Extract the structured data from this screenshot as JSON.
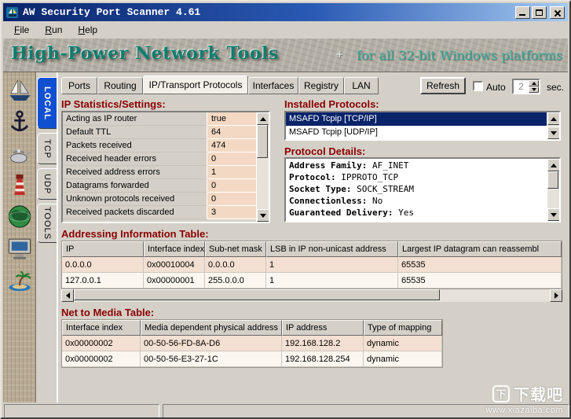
{
  "colors": {
    "titlebar_left": "#0a246a",
    "titlebar_right": "#a6caf0",
    "base_gray": "#d4d0c8",
    "local_tab_blue": "#1050d0",
    "selection_blue": "#0a246a",
    "heading_red": "#8b0000",
    "value_cell_bg": "#f3d9c3",
    "banner_teal": "#0d7d6e",
    "banner_subtitle_teal": "#3aaf9f"
  },
  "window": {
    "title": "AW Security Port Scanner 4.61"
  },
  "menu": [
    "File",
    "Run",
    "Help"
  ],
  "banner": {
    "title": "High-Power Network Tools",
    "spark": "+",
    "subtitle": "for all 32-bit Windows platforms"
  },
  "sidebar_icons": [
    "sailboat",
    "anchor",
    "lamp",
    "lighthouse",
    "globe",
    "computer",
    "island"
  ],
  "side_tabs": {
    "items": [
      "LOCAL",
      "TCP",
      "UDP",
      "TOOLS"
    ],
    "active": "LOCAL"
  },
  "tabs": {
    "items": [
      "Ports",
      "Routing",
      "IP/Transport Protocols",
      "Interfaces",
      "Registry",
      "LAN"
    ],
    "active": "IP/Transport Protocols"
  },
  "toolbar": {
    "refresh_label": "Refresh",
    "auto_label": "Auto",
    "auto_checked": false,
    "interval_value": "2",
    "interval_unit": "sec."
  },
  "stats": {
    "heading": "IP Statistics/Settings:",
    "rows": [
      {
        "label": "Acting as IP router",
        "value": "true"
      },
      {
        "label": "Default TTL",
        "value": "64"
      },
      {
        "label": "Packets received",
        "value": "474"
      },
      {
        "label": "Received header errors",
        "value": "0"
      },
      {
        "label": "Received address errors",
        "value": "1"
      },
      {
        "label": "Datagrams forwarded",
        "value": "0"
      },
      {
        "label": "Unknown protocols received",
        "value": "0"
      },
      {
        "label": "Received packets discarded",
        "value": "3"
      }
    ]
  },
  "protocols": {
    "heading": "Installed Protocols:",
    "items": [
      "MSAFD Tcpip [TCP/IP]",
      "MSAFD Tcpip [UDP/IP]"
    ],
    "selected": "MSAFD Tcpip [TCP/IP]"
  },
  "details": {
    "heading": "Protocol Details:",
    "lines": [
      {
        "label": "Address Family:",
        "value": "AF_INET"
      },
      {
        "label": "Protocol:",
        "value": "IPPROTO_TCP"
      },
      {
        "label": "Socket Type:",
        "value": "SOCK_STREAM"
      },
      {
        "label": "Connectionless:",
        "value": "No"
      },
      {
        "label": "Guaranteed Delivery:",
        "value": "Yes"
      }
    ]
  },
  "addr": {
    "heading": "Addressing Information Table:",
    "columns": [
      "IP",
      "Interface index",
      "Sub-net mask",
      "LSB in IP non-unicast address",
      "Largest IP datagram can reassembl"
    ],
    "rows": [
      [
        "0.0.0.0",
        "0x00010004",
        "0.0.0.0",
        "1",
        "65535"
      ],
      [
        "127.0.0.1",
        "0x00000001",
        "255.0.0.0",
        "1",
        "65535"
      ]
    ]
  },
  "ntm": {
    "heading": "Net to Media Table:",
    "columns": [
      "Interface index",
      "Media dependent physical address",
      "IP address",
      "Type of mapping"
    ],
    "rows": [
      [
        "0x00000002",
        "00-50-56-FD-8A-D6",
        "192.168.128.2",
        "dynamic"
      ],
      [
        "0x00000002",
        "00-50-56-E3-27-1C",
        "192.168.128.254",
        "dynamic"
      ]
    ]
  },
  "watermark": {
    "logo": "下",
    "brand": "下载吧",
    "url": "www.xiazaiba.com"
  }
}
